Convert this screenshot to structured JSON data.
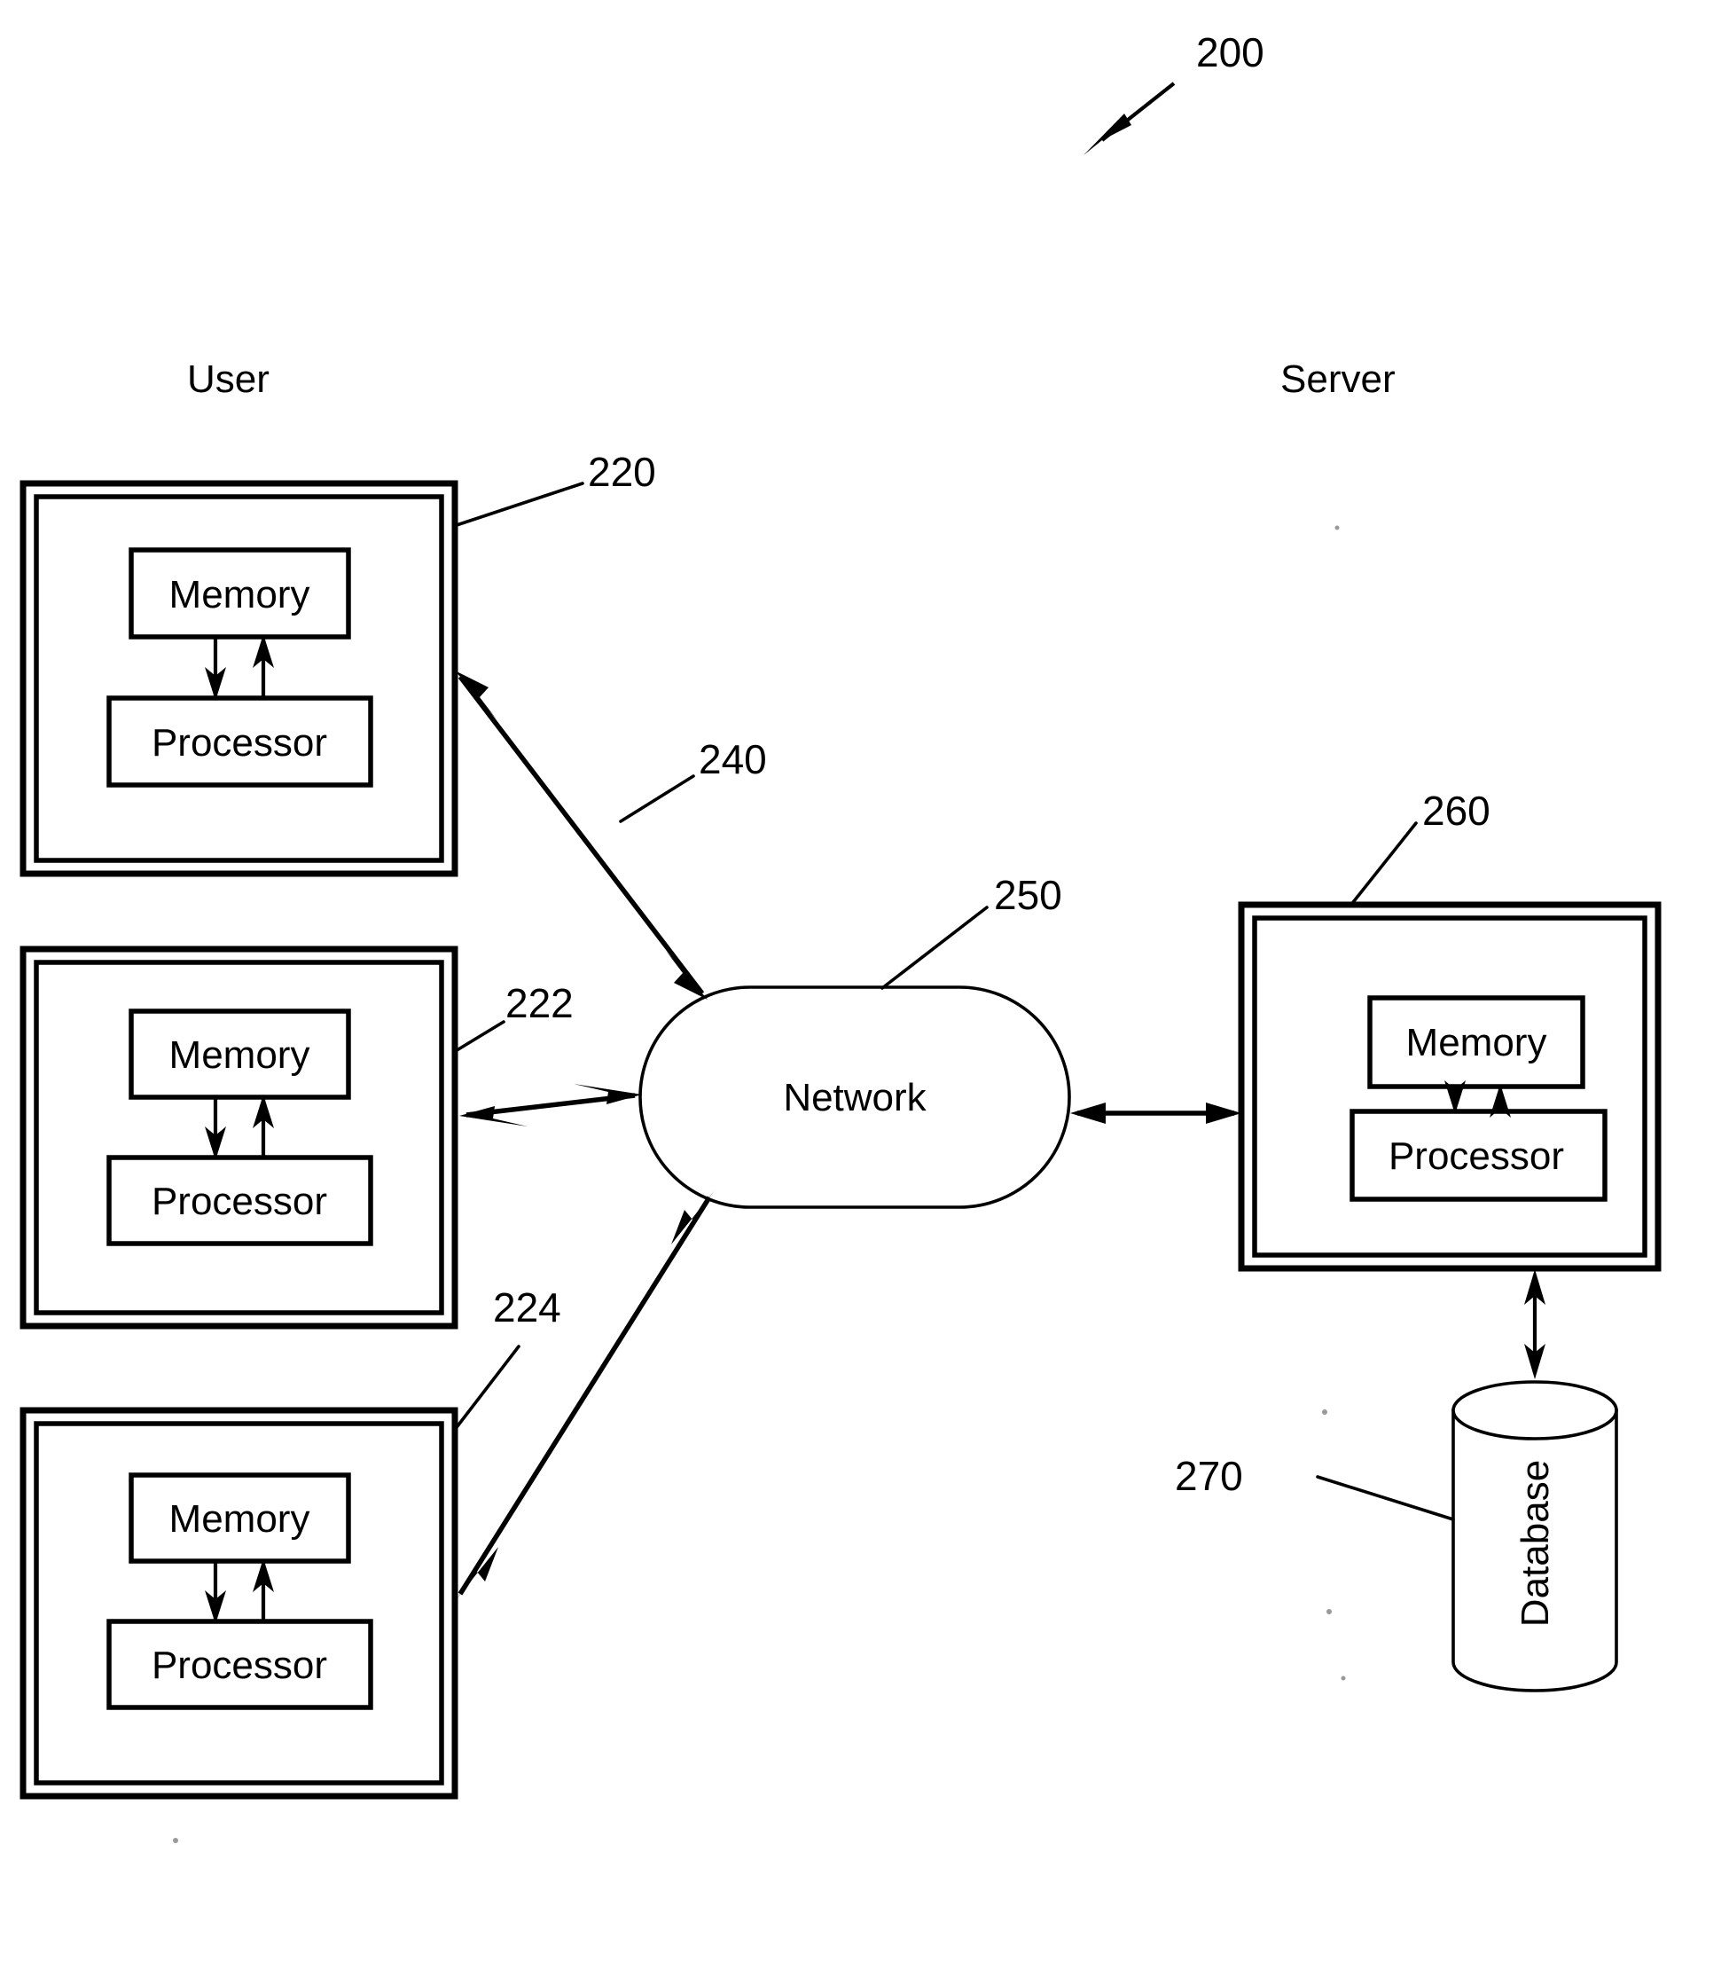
{
  "figure": {
    "reference_numeral": "200",
    "type": "system-architecture-diagram"
  },
  "headings": {
    "user": "User",
    "server": "Server"
  },
  "user_devices": [
    {
      "ref": "220",
      "memory_label": "Memory",
      "processor_label": "Processor"
    },
    {
      "ref": "222",
      "memory_label": "Memory",
      "processor_label": "Processor"
    },
    {
      "ref": "224",
      "memory_label": "Memory",
      "processor_label": "Processor"
    }
  ],
  "network": {
    "ref": "250",
    "label": "Network"
  },
  "connections": {
    "ref": "240"
  },
  "server": {
    "ref": "260",
    "memory_label": "Memory",
    "processor_label": "Processor"
  },
  "database": {
    "ref": "270",
    "label": "Database"
  },
  "colors": {
    "ink": "#000000",
    "paper": "#ffffff"
  }
}
